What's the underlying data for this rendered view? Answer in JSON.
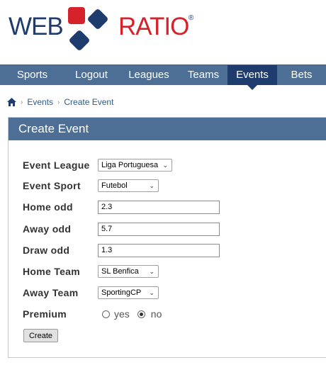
{
  "logo": {
    "part1": "WEB",
    "part2": "RATIO",
    "reg": "®"
  },
  "nav": {
    "items": [
      {
        "label": "Sports",
        "active": false
      },
      {
        "label": "Logout",
        "active": false
      },
      {
        "label": "Leagues",
        "active": false
      },
      {
        "label": "Teams",
        "active": false
      },
      {
        "label": "Events",
        "active": true
      },
      {
        "label": "Bets",
        "active": false
      }
    ]
  },
  "breadcrumb": {
    "items": [
      "Events",
      "Create Event"
    ]
  },
  "panel": {
    "title": "Create Event"
  },
  "form": {
    "event_league": {
      "label": "Event League",
      "value": "Liga Portuguesa"
    },
    "event_sport": {
      "label": "Event Sport",
      "value": "Futebol"
    },
    "home_odd": {
      "label": "Home odd",
      "value": "2.3"
    },
    "away_odd": {
      "label": "Away odd",
      "value": "5.7"
    },
    "draw_odd": {
      "label": "Draw odd",
      "value": "1.3"
    },
    "home_team": {
      "label": "Home Team",
      "value": "SL Benfica"
    },
    "away_team": {
      "label": "Away Team",
      "value": "SportingCP"
    },
    "premium": {
      "label": "Premium",
      "options": [
        "yes",
        "no"
      ],
      "selected": "no"
    },
    "create_label": "Create"
  },
  "colors": {
    "nav_bg": "#4d6f96",
    "nav_active": "#1f3c6e",
    "brand_red": "#d6222a",
    "brand_blue": "#1f3c6e"
  }
}
